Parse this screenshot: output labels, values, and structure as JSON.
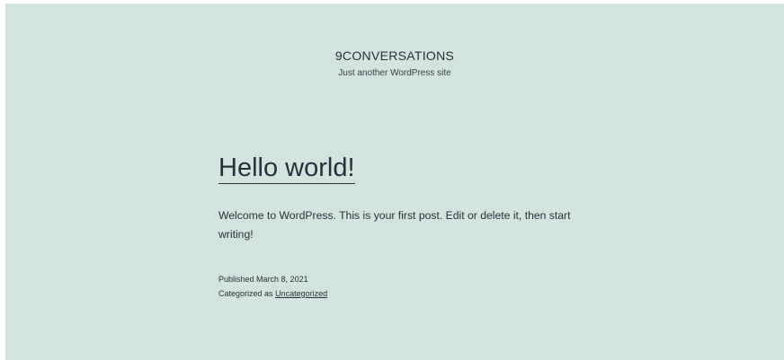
{
  "header": {
    "site_title": "9CONVERSATIONS",
    "site_description": "Just another WordPress site"
  },
  "post": {
    "title": "Hello world!",
    "content": "Welcome to WordPress. This is your first post. Edit or delete it, then start writing!",
    "published_label": "Published",
    "published_date": "March 8, 2021",
    "categorized_label": "Categorized as",
    "category": "Uncategorized"
  },
  "colors": {
    "background": "#d1e4dd",
    "text": "#28303d"
  }
}
